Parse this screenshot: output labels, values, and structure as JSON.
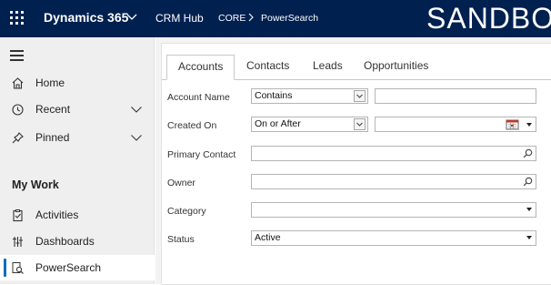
{
  "topbar": {
    "app_name": "Dynamics 365",
    "hub_name": "CRM Hub",
    "breadcrumb": [
      "CORE",
      "PowerSearch"
    ],
    "environment": "SANDBOX",
    "color": "#002050"
  },
  "sidebar": {
    "items": [
      {
        "label": "Home",
        "icon": "home-icon"
      },
      {
        "label": "Recent",
        "icon": "clock-icon",
        "expandable": true
      },
      {
        "label": "Pinned",
        "icon": "pin-icon",
        "expandable": true
      }
    ],
    "section_title": "My Work",
    "work_items": [
      {
        "label": "Activities",
        "icon": "clipboard-icon"
      },
      {
        "label": "Dashboards",
        "icon": "dashboard-icon"
      },
      {
        "label": "PowerSearch",
        "icon": "powersearch-icon",
        "active": true
      }
    ],
    "active_color": "#0f6cbd"
  },
  "tabs": [
    {
      "label": "Accounts",
      "selected": true
    },
    {
      "label": "Contacts"
    },
    {
      "label": "Leads"
    },
    {
      "label": "Opportunities"
    }
  ],
  "form": {
    "account_name": {
      "label": "Account Name",
      "operator": "Contains",
      "value": ""
    },
    "created_on": {
      "label": "Created On",
      "operator": "On or After",
      "value": ""
    },
    "primary_contact": {
      "label": "Primary Contact",
      "value": ""
    },
    "owner": {
      "label": "Owner",
      "value": ""
    },
    "category": {
      "label": "Category",
      "value": ""
    },
    "status": {
      "label": "Status",
      "value": "Active"
    }
  }
}
